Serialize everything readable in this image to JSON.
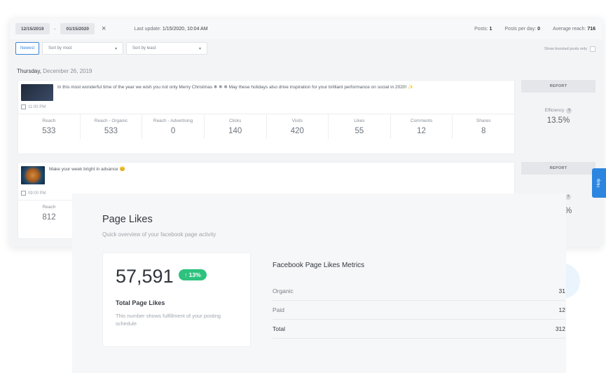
{
  "topbar": {
    "date_from": "12/15/2019",
    "date_to": "01/15/2020",
    "clear": "×",
    "last_update_label": "Last update:",
    "last_update_value": "1/15/2020, 10:04 AM",
    "posts_label": "Posts:",
    "posts_value": "1",
    "posts_per_day_label": "Posts per day:",
    "posts_per_day_value": "0",
    "avg_reach_label": "Average reach:",
    "avg_reach_value": "716"
  },
  "filters": {
    "newest": "Newest",
    "sort_most": "Sort by most",
    "sort_least": "Sort by least",
    "boosted": "Show boosted posts only"
  },
  "day": {
    "weekday": "Thursday,",
    "date": "December 26, 2019"
  },
  "posts": [
    {
      "text": "In this most wonderful time of the year we wish you not only Merry Christmas ❄ ❄ ❄ May these holidays also drive inspiration for your brilliant performance on social in 2020! ✨",
      "time": "11:00 PM",
      "report": "REPORT",
      "efficiency_label": "Efficiency",
      "efficiency_value": "13.5%",
      "metrics": [
        {
          "label": "Reach",
          "value": "533"
        },
        {
          "label": "Reach - Organic",
          "value": "533"
        },
        {
          "label": "Reach - Advertising",
          "value": "0"
        },
        {
          "label": "Clicks",
          "value": "140"
        },
        {
          "label": "Visits",
          "value": "420"
        },
        {
          "label": "Likes",
          "value": "55"
        },
        {
          "label": "Comments",
          "value": "12"
        },
        {
          "label": "Shares",
          "value": "8"
        }
      ]
    },
    {
      "text": "Make your week bright in advance 😊",
      "time": "09:00 PM",
      "report": "REPORT",
      "efficiency_value": "%",
      "metrics": [
        {
          "label": "Reach",
          "value": "812"
        }
      ]
    }
  ],
  "help": "Help",
  "card": {
    "title": "Page Likes",
    "subtitle": "Quick overview of your facebook page activity",
    "total_value": "57,591",
    "change": "↑ 13%",
    "total_label": "Total Page Likes",
    "total_desc": "This number shows fulfillment of your posting schedule",
    "metrics_title": "Facebook Page Likes Metrics",
    "rows": [
      {
        "label": "Organic",
        "value": "31"
      },
      {
        "label": "Paid",
        "value": "12"
      },
      {
        "label": "Total",
        "value": "312"
      }
    ]
  },
  "colors": {
    "accent": "#2c86e0",
    "positive": "#2ec27e"
  }
}
